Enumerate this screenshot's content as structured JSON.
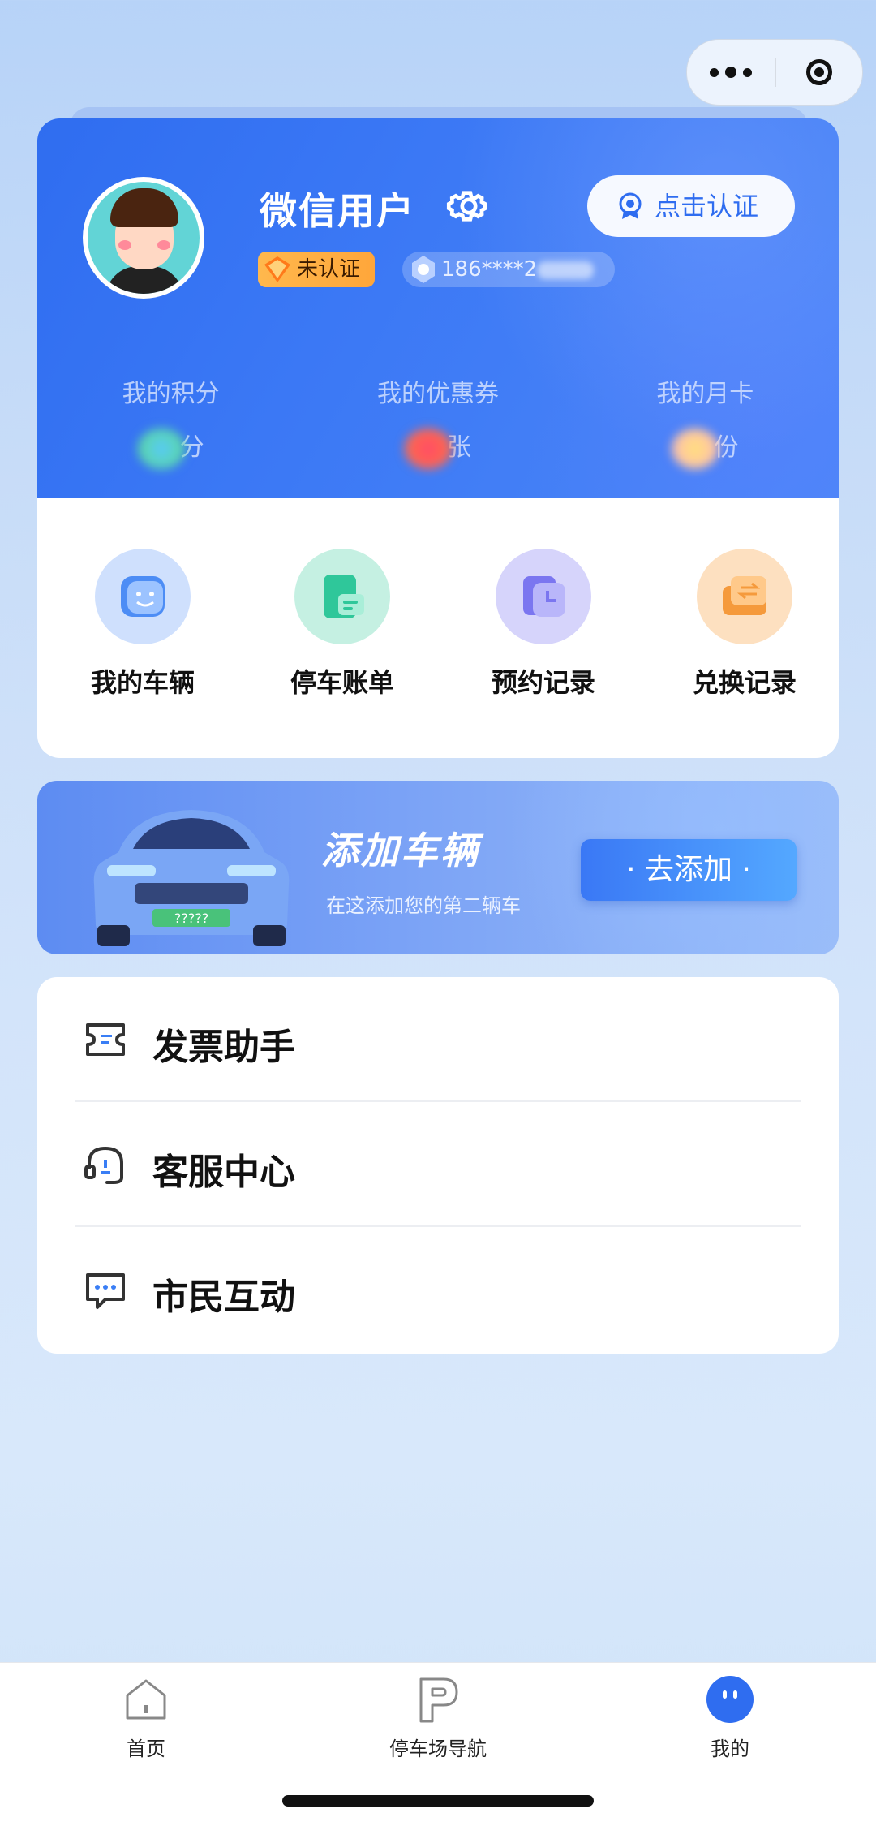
{
  "capsule": {
    "more_icon": "more-dots-icon",
    "close_icon": "target-icon"
  },
  "profile": {
    "username": "微信用户",
    "unverified_badge": "未认证",
    "phone": "186****2",
    "verify_button": "点击认证",
    "stats": [
      {
        "label": "我的积分",
        "unit": "分"
      },
      {
        "label": "我的优惠券",
        "unit": "张"
      },
      {
        "label": "我的月卡",
        "unit": "份"
      }
    ]
  },
  "quick_actions": [
    {
      "label": "我的车辆",
      "icon": "car-face-icon",
      "color": "#4d8df5"
    },
    {
      "label": "停车账单",
      "icon": "bill-icon",
      "color": "#2fc79a"
    },
    {
      "label": "预约记录",
      "icon": "clock-card-icon",
      "color": "#7b76f0"
    },
    {
      "label": "兑换记录",
      "icon": "exchange-wallet-icon",
      "color": "#f59a3c"
    }
  ],
  "banner": {
    "title": "添加车辆",
    "subtitle": "在这添加您的第二辆车",
    "button": "· 去添加 ·",
    "plate": "?????"
  },
  "menu": [
    {
      "label": "发票助手",
      "icon": "ticket-icon"
    },
    {
      "label": "客服中心",
      "icon": "headset-icon"
    },
    {
      "label": "市民互动",
      "icon": "chat-icon"
    }
  ],
  "tabbar": [
    {
      "label": "首页",
      "icon": "home-icon"
    },
    {
      "label": "停车场导航",
      "icon": "parking-icon"
    },
    {
      "label": "我的",
      "icon": "me-icon",
      "active": true
    }
  ]
}
